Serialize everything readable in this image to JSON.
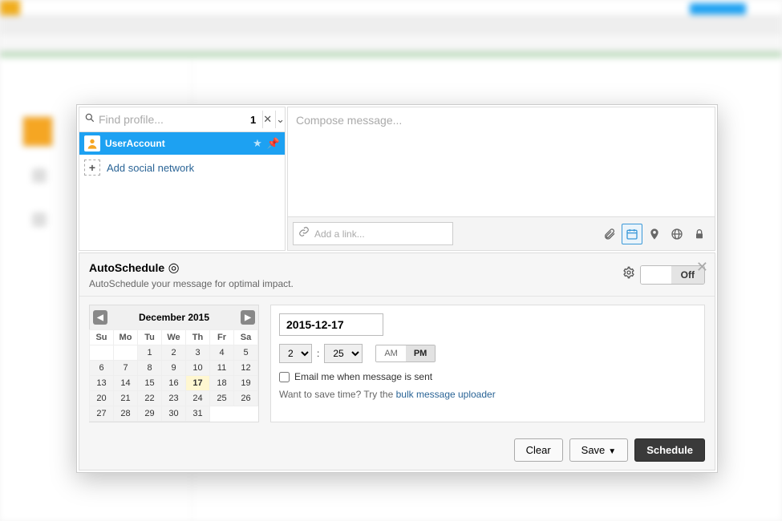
{
  "profile_panel": {
    "search_placeholder": "Find profile...",
    "count": "1",
    "selected": "UserAccount",
    "add_label": "Add social network"
  },
  "compose": {
    "placeholder": "Compose message...",
    "link_placeholder": "Add a link..."
  },
  "autoschedule": {
    "title": "AutoSchedule",
    "desc": "AutoSchedule your message for optimal impact.",
    "off": "Off"
  },
  "calendar": {
    "month": "December 2015",
    "dow": [
      "Su",
      "Mo",
      "Tu",
      "We",
      "Th",
      "Fr",
      "Sa"
    ],
    "prev_blanks": 2,
    "days": 31,
    "selected": 17
  },
  "time": {
    "date": "2015-12-17",
    "hour": "2",
    "minute": "25",
    "am": "AM",
    "pm": "PM",
    "email_label": "Email me when message is sent",
    "hint_pre": "Want to save time? Try the ",
    "hint_link": "bulk message uploader"
  },
  "actions": {
    "clear": "Clear",
    "save": "Save",
    "schedule": "Schedule"
  }
}
